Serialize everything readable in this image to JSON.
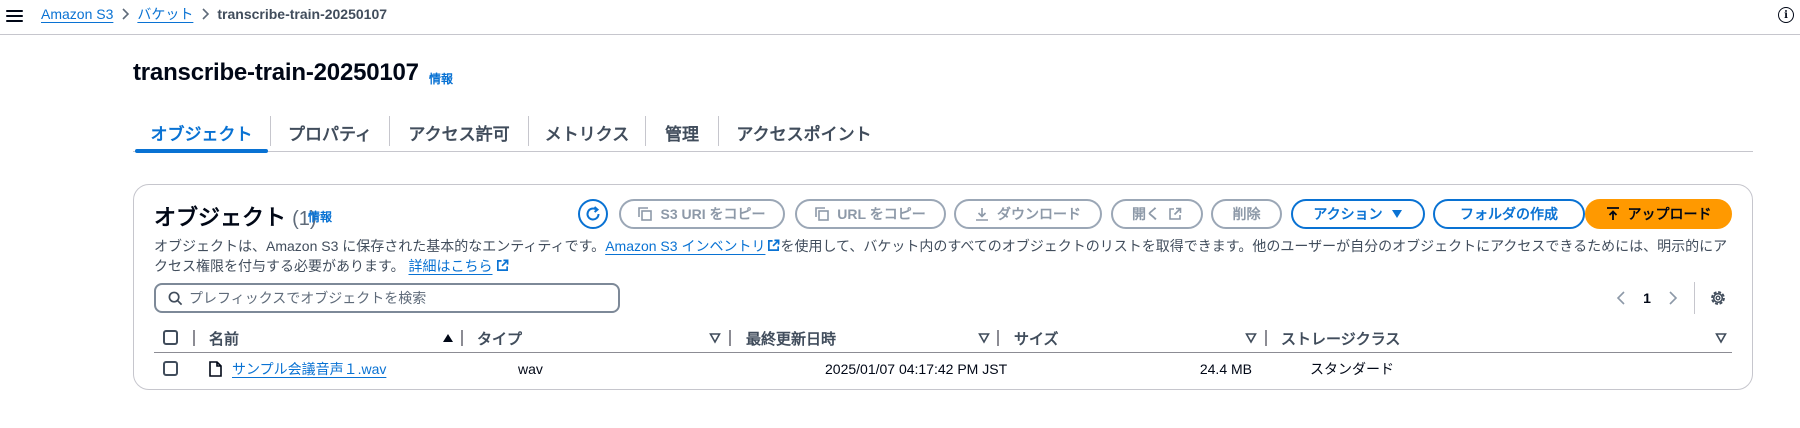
{
  "breadcrumb": {
    "items": [
      "Amazon S3",
      "バケット"
    ],
    "current": "transcribe-train-20250107"
  },
  "page": {
    "title": "transcribe-train-20250107",
    "info": "情報"
  },
  "tabs": [
    "オブジェクト",
    "プロパティ",
    "アクセス許可",
    "メトリクス",
    "管理",
    "アクセスポイント"
  ],
  "panel": {
    "title": "オブジェクト",
    "count": "(1)",
    "info": "情報",
    "buttons": {
      "copy_s3_uri": "S3 URI をコピー",
      "copy_url": "URL をコピー",
      "download": "ダウンロード",
      "open": "開く",
      "delete": "削除",
      "actions": "アクション",
      "create_folder": "フォルダの作成",
      "upload": "アップロード"
    },
    "description": {
      "part1": "オブジェクトは、Amazon S3 に保存された基本的なエンティティです。",
      "link1": "Amazon S3 インベントリ",
      "part2": "を使用して、バケット内のすべてのオブジェクトのリストを取得できます。他のユーザーが自分のオブジェクトにアクセスできるためには、明示的にアクセス権限を付与する必要があります。",
      "link2": "詳細はこちら"
    },
    "search": {
      "placeholder": "プレフィックスでオブジェクトを検索",
      "value": ""
    },
    "pagination": {
      "current_page": "1"
    },
    "table": {
      "columns": [
        "名前",
        "タイプ",
        "最終更新日時",
        "サイズ",
        "ストレージクラス"
      ],
      "rows": [
        {
          "name": "サンプル会議音声１.wav",
          "type": "wav",
          "modified": "2025/01/07 04:17:42 PM JST",
          "size": "24.4 MB",
          "storage_class": "スタンダード"
        }
      ]
    }
  },
  "colors": {
    "link": "#0972d3",
    "primary_button": "#ff9900",
    "disabled": "#8d99a8",
    "border": "#c6c6cd"
  }
}
